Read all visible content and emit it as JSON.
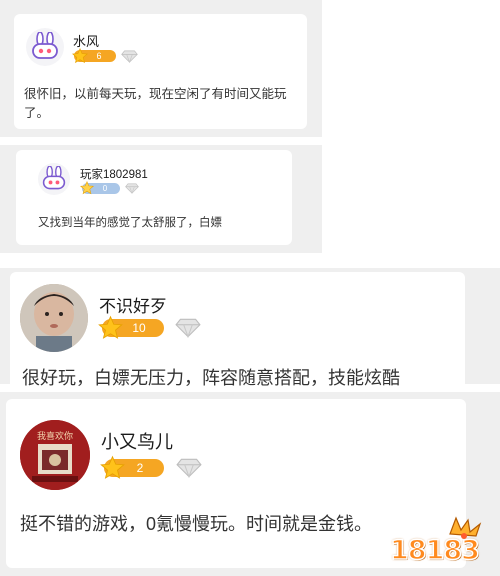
{
  "comments": [
    {
      "username": "水风",
      "level": "6",
      "text": "很怀旧，以前每天玩，现在空闲了有时间又能玩了。",
      "avatar": "bunny-avatar-icon"
    },
    {
      "username": "玩家1802981",
      "level": "0",
      "text": "又找到当年的感觉了太舒服了，白嫖",
      "avatar": "bunny-avatar-icon"
    },
    {
      "username": "不识好歹",
      "level": "10",
      "text": "很好玩，白嫖无压力，阵容随意搭配，技能炫酷",
      "avatar": "child-photo-avatar"
    },
    {
      "username": "小又鸟儿",
      "level": "2",
      "text": "挺不错的游戏，0氪慢慢玩。时间就是金钱。",
      "avatar": "red-painting-avatar",
      "avatar_text": "我喜欢你"
    }
  ],
  "watermark": {
    "text": "18183",
    "icon": "18183-logo-icon"
  },
  "colors": {
    "level_badge_active": "#f5a623",
    "level_badge_zero": "#a9c6e8",
    "star": "#ffc21a",
    "diamond": "#d6d6d6",
    "panel_bg": "#efefef",
    "logo_orange": "#ff8a1e"
  }
}
